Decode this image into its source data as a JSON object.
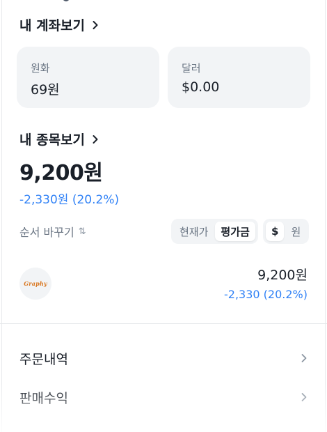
{
  "account": {
    "section_title": "내 계좌보기",
    "cards": [
      {
        "label": "원화",
        "value": "69원"
      },
      {
        "label": "달러",
        "value": "$0.00"
      }
    ]
  },
  "stocks": {
    "section_title": "내 종목보기",
    "total_value": "9,200원",
    "total_change": "-2,330원 (20.2%)",
    "sort_label": "순서 바꾸기",
    "sort_icon": "⇅",
    "view_toggle": {
      "options": [
        "현재가",
        "평가금"
      ],
      "selected": "평가금"
    },
    "currency_toggle": {
      "options": [
        "$",
        "원"
      ],
      "selected": "$"
    },
    "holdings": [
      {
        "logo_text": "Graphy",
        "amount": "9,200원",
        "change": "-2,330 (20.2%)"
      }
    ]
  },
  "menu": [
    {
      "label": "주문내역"
    },
    {
      "label": "판매수익"
    }
  ],
  "colors": {
    "accent_blue": "#3182f6",
    "card_bg": "#f2f4f6",
    "text_primary": "#191f28",
    "text_secondary": "#6b7684",
    "logo_orange": "#d9761f"
  },
  "icons": {
    "chevron_right": "chevron-right-icon",
    "sort": "sort-arrows-icon"
  }
}
